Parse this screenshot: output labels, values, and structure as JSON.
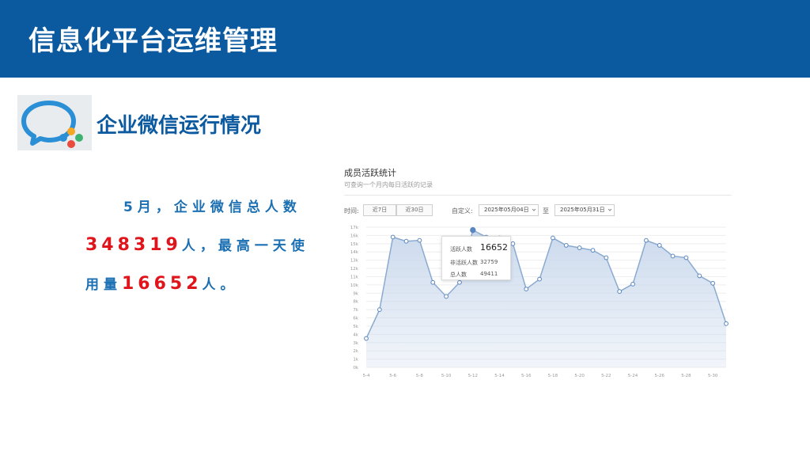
{
  "page": {
    "title": "信息化平台运维管理"
  },
  "section": {
    "title": "企业微信运行情况",
    "logo_icon": "wecom-logo-icon"
  },
  "summary": {
    "line1": "5月，企业微信总人数",
    "total": "348319",
    "middle": "人，最高一天使",
    "prefix3": "用量",
    "peak": "16652",
    "suffix": "人。"
  },
  "chart_panel": {
    "title": "成员活跃统计",
    "subtitle": "可查询一个月内每日活跃的记录",
    "time_label": "时间:",
    "btn_7": "近7日",
    "btn_30": "近30日",
    "custom_label": "自定义:",
    "date_from": "2025年05月04日",
    "to_label": "至",
    "date_to": "2025年05月31日",
    "tooltip": {
      "active_label": "活跃人数",
      "active_value": "16652",
      "inactive_label": "非活跃人数",
      "inactive_value": "32759",
      "total_label": "总人数",
      "total_value": "49411"
    }
  },
  "chart_data": {
    "type": "area",
    "x": [
      "5-4",
      "5-5",
      "5-6",
      "5-7",
      "5-8",
      "5-9",
      "5-10",
      "5-11",
      "5-12",
      "5-13",
      "5-14",
      "5-15",
      "5-16",
      "5-17",
      "5-18",
      "5-19",
      "5-20",
      "5-21",
      "5-22",
      "5-23",
      "5-24",
      "5-25",
      "5-26",
      "5-27",
      "5-28",
      "5-29",
      "5-30",
      "5-31"
    ],
    "y": [
      3500,
      7000,
      15800,
      15300,
      15400,
      10300,
      8600,
      10300,
      16652,
      15800,
      15700,
      15000,
      9500,
      10700,
      15700,
      14800,
      14500,
      14200,
      13300,
      9200,
      10100,
      15400,
      14800,
      13500,
      13300,
      11100,
      10200,
      5300
    ],
    "xticks": [
      "5-4",
      "5-6",
      "5-8",
      "5-10",
      "5-12",
      "5-14",
      "5-16",
      "5-18",
      "5-20",
      "5-22",
      "5-24",
      "5-26",
      "5-28",
      "5-30"
    ],
    "yticks": [
      "0k",
      "1k",
      "2k",
      "3k",
      "4k",
      "5k",
      "6k",
      "7k",
      "8k",
      "9k",
      "10k",
      "11k",
      "12k",
      "13k",
      "14k",
      "15k",
      "16k",
      "17k"
    ],
    "ylim": [
      0,
      17000
    ],
    "grid": true,
    "line_color": "#8aaad0",
    "fill_color": "#c9d8ec",
    "point_color": "#5a86bf"
  }
}
